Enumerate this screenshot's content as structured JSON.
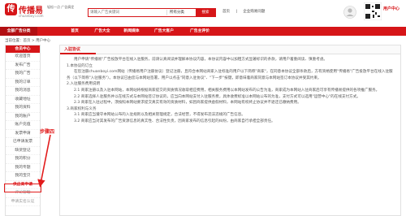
{
  "header": {
    "logo_mark": "传",
    "logo_text": "传播易",
    "logo_sub": "chuanboyi.com",
    "slogan": "轻松一点 广告搞定",
    "search": {
      "placeholder": "请输入广告关键词",
      "category": "所有分类",
      "button": "搜索"
    },
    "links": [
      "首页",
      "|",
      "企业购易问题"
    ],
    "customer_service": "用户中心"
  },
  "nav": {
    "items": [
      "全部广告分类",
      "首页",
      "广告大全",
      "新闻媒体",
      "广告大客户",
      "广告主评价"
    ]
  },
  "breadcrumb": "当前位置：首页 > 用户中心",
  "sidebar": {
    "title": "会员中心",
    "items": [
      "欢迎首页",
      "发布广告",
      "我的广告",
      "我的订单",
      "我的消息",
      "收藏地址",
      "我的资料",
      "我的账户",
      "账户充值",
      "发票申请",
      "已申请发票",
      "缺货登记",
      "我的积分",
      "我的专题",
      "我的宝贝",
      "供应商申请",
      "评论管理",
      "申请实名认证"
    ]
  },
  "main": {
    "title": "入驻协议",
    "paragraphs": [
      "用户申请\"传播易\"广告投放平台在线入驻服务，前请认真阅读并理解本协议内容，本协议内容中以加粗方式显著标识的条款，请用户着重阅读、慎重考虑。",
      "1.本协议的订立",
      "在您注册chuanboyi.com网站（传播易用户注册协议）登记注册，且符合本网站商家入驻标准的用户以下简称\"商家\"，在同意本协议全部条款后，方有资格使用\"传播易\"广告投放平台在线入驻服务（以下简称\"入驻服务\"）。本协议已由您与本网站签署，用户以点击\"同意入驻协议\"、\"下一步\"按键，即意味着商家同意与本网站签订本协议并受其约束。",
      "2.入驻服务费用说明",
      "2.1 商家注册以及入驻本网站，本网站将根据商家提交的资质情况收取相应费用，相关服务费用以本网站发布的公告为准，商家成为本网站入驻商家后可享有传播易提供的各项推广服务。",
      "2.2 商家选择人驻服务并以在线方式与本网站签订协议的，应当向本网站支付入驻服务费，具体收费标准以本网站公布的为准，支付方式可以选用\"运营中心\"的在线支付方式。",
      "2.3 商家在入驻过程中，须按照本网站要求提交真实有效的资质材料，如因商家提供虚假材料，本网站有权终止协议并不退还已缴纳费用。",
      "3.商家权利与义务",
      "3.1 商家应当遵守本网站公布的入驻规则以及相关管理规定，合法经营，不得发布违法违规的广告信息。",
      "3.2 商家应当对其发布的广告资源信息的真实性、合法性负责，因商家发布的信息引起的纠纷，由商家自行承担全部责任。"
    ]
  },
  "annotation": {
    "label": "步骤四",
    "highlight_index": 15
  }
}
